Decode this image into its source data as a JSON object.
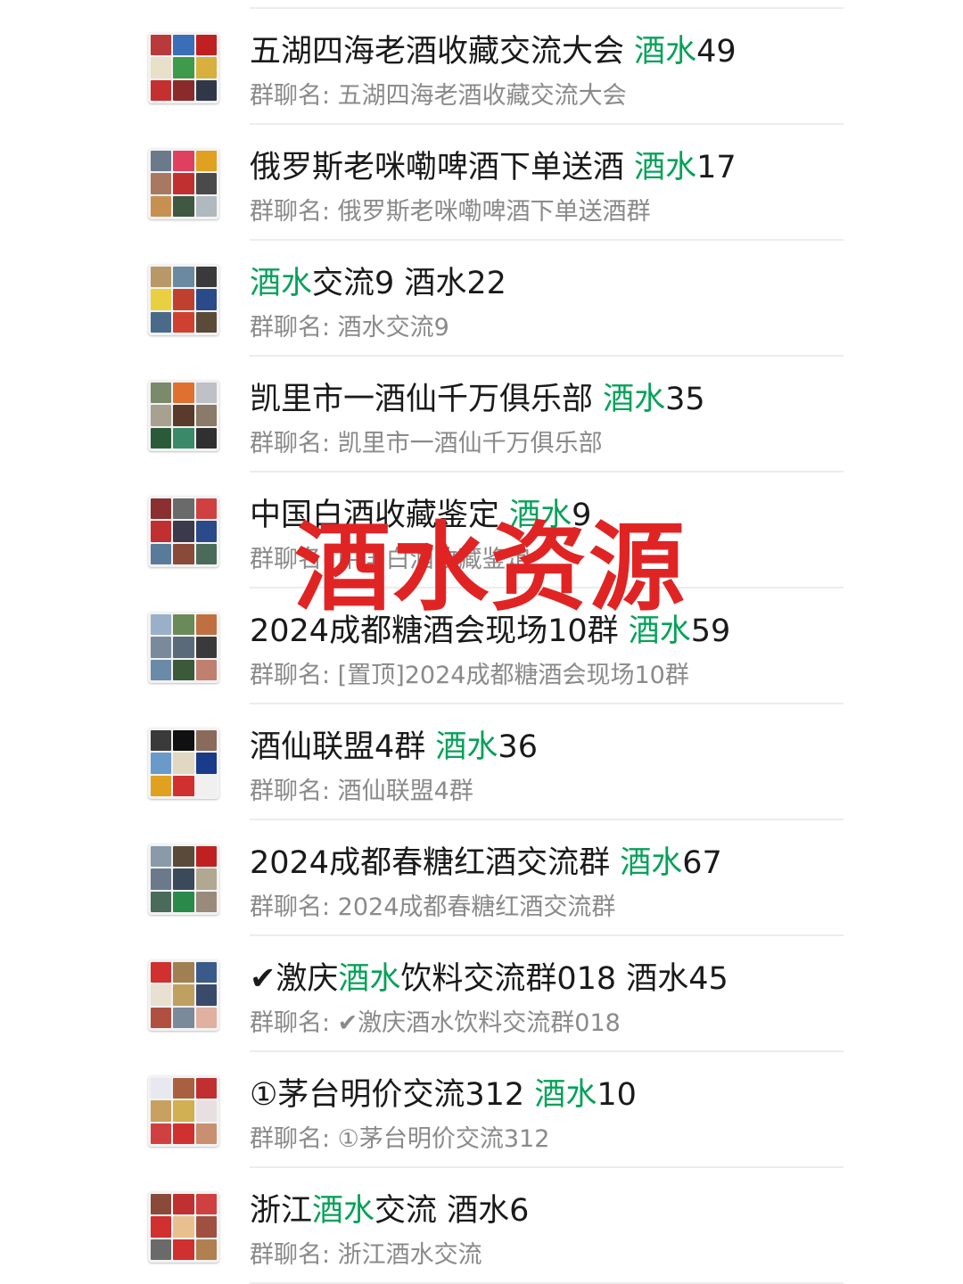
{
  "groups": [
    {
      "title_parts": [
        {
          "t": "五湖四海老酒收藏交流大会 "
        },
        {
          "t": "酒水",
          "hl": true
        },
        {
          "t": "49"
        }
      ],
      "subtitle": "群聊名: 五湖四海老酒收藏交流大会",
      "avatar_colors": [
        "#b83a3a",
        "#3a6fb8",
        "#c02020",
        "#e8e0c8",
        "#3f9a4a",
        "#d8b040",
        "#c43030",
        "#8a2a2a",
        "#303848"
      ]
    },
    {
      "title_parts": [
        {
          "t": "俄罗斯老咪嘞啤酒下单送酒  "
        },
        {
          "t": "酒水",
          "hl": true
        },
        {
          "t": "17"
        }
      ],
      "subtitle": "群聊名: 俄罗斯老咪嘞啤酒下单送酒群",
      "avatar_colors": [
        "#6a7a8a",
        "#e04060",
        "#e0a020",
        "#a87860",
        "#c03030",
        "#4a4a4a",
        "#c89050",
        "#405840",
        "#b0b8c0"
      ]
    },
    {
      "title_parts": [
        {
          "t": "酒水",
          "hl": true
        },
        {
          "t": "交流9 酒水22"
        }
      ],
      "subtitle": "群聊名: 酒水交流9",
      "avatar_colors": [
        "#b89868",
        "#6a8aa0",
        "#3a3a3a",
        "#e8d040",
        "#c04030",
        "#2a4a8a",
        "#4a6a8a",
        "#d04030",
        "#5a4a3a"
      ]
    },
    {
      "title_parts": [
        {
          "t": "凯里市一酒仙千万俱乐部 "
        },
        {
          "t": "酒水",
          "hl": true
        },
        {
          "t": "35"
        }
      ],
      "subtitle": "群聊名: 凯里市一酒仙千万俱乐部",
      "avatar_colors": [
        "#7a8a6a",
        "#e07030",
        "#c0c0c8",
        "#a8a090",
        "#5a3a2a",
        "#8a7a6a",
        "#2a5a3a",
        "#3a8a6a",
        "#303030"
      ]
    },
    {
      "title_parts": [
        {
          "t": "中国白酒收藏鉴定 "
        },
        {
          "t": "酒水",
          "hl": true
        },
        {
          "t": "9"
        }
      ],
      "subtitle": "群聊名: 中国白酒收藏鉴定",
      "avatar_colors": [
        "#8a3030",
        "#6a6a6a",
        "#d04040",
        "#c03030",
        "#3a3a4a",
        "#2a4a8a",
        "#5a7a9a",
        "#8a4a3a",
        "#4a6a5a"
      ]
    },
    {
      "title_parts": [
        {
          "t": "2024成都糖酒会现场10群  "
        },
        {
          "t": "酒水",
          "hl": true
        },
        {
          "t": "59"
        }
      ],
      "subtitle": "群聊名: [置顶]2024成都糖酒会现场10群",
      "avatar_colors": [
        "#9ab0c8",
        "#6a8a5a",
        "#c07040",
        "#7a8a9a",
        "#5a6a7a",
        "#3a3a3a",
        "#6a8aa8",
        "#3a5a3a",
        "#c08070"
      ]
    },
    {
      "title_parts": [
        {
          "t": "酒仙联盟4群 "
        },
        {
          "t": "酒水",
          "hl": true
        },
        {
          "t": "36"
        }
      ],
      "subtitle": "群聊名: 酒仙联盟4群",
      "avatar_colors": [
        "#3a3a3a",
        "#101010",
        "#8a6a5a",
        "#6a9ac8",
        "#e0d8c0",
        "#1a3a8a",
        "#e0a020",
        "#d03030",
        "#f0f0f0"
      ]
    },
    {
      "title_parts": [
        {
          "t": "2024成都春糖红酒交流群 "
        },
        {
          "t": "酒水",
          "hl": true
        },
        {
          "t": "67"
        }
      ],
      "subtitle": "群聊名: 2024成都春糖红酒交流群",
      "avatar_colors": [
        "#8a9aa8",
        "#5a4a3a",
        "#c02020",
        "#6a7a8a",
        "#3a4a5a",
        "#b0a890",
        "#4a6a5a",
        "#2a8a4a",
        "#9a8a7a"
      ]
    },
    {
      "title_parts": [
        {
          "t": "✔激庆"
        },
        {
          "t": "酒水",
          "hl": true
        },
        {
          "t": "饮料交流群018 酒水45"
        }
      ],
      "subtitle": "群聊名: ✔激庆酒水饮料交流群018",
      "avatar_colors": [
        "#d03030",
        "#a08050",
        "#3a5a8a",
        "#e8e0d0",
        "#c0a060",
        "#3a4a6a",
        "#b05040",
        "#7a8a9a",
        "#e0b0a0"
      ]
    },
    {
      "title_parts": [
        {
          "t": "①茅台明价交流312  "
        },
        {
          "t": "酒水",
          "hl": true
        },
        {
          "t": "10"
        }
      ],
      "subtitle": "群聊名: ①茅台明价交流312",
      "avatar_colors": [
        "#e8e8f0",
        "#a86040",
        "#c03030",
        "#c8a060",
        "#d0b050",
        "#e8e0e0",
        "#d04040",
        "#d03030",
        "#c89070"
      ]
    },
    {
      "title_parts": [
        {
          "t": "浙江"
        },
        {
          "t": "酒水",
          "hl": true
        },
        {
          "t": "交流 酒水6"
        }
      ],
      "subtitle": "群聊名: 浙江酒水交流",
      "avatar_colors": [
        "#8a4a3a",
        "#c03030",
        "#d04040",
        "#d03030",
        "#e8c090",
        "#a05040",
        "#6a6a6a",
        "#d03030",
        "#b08050"
      ]
    }
  ],
  "watermark": "酒水资源"
}
